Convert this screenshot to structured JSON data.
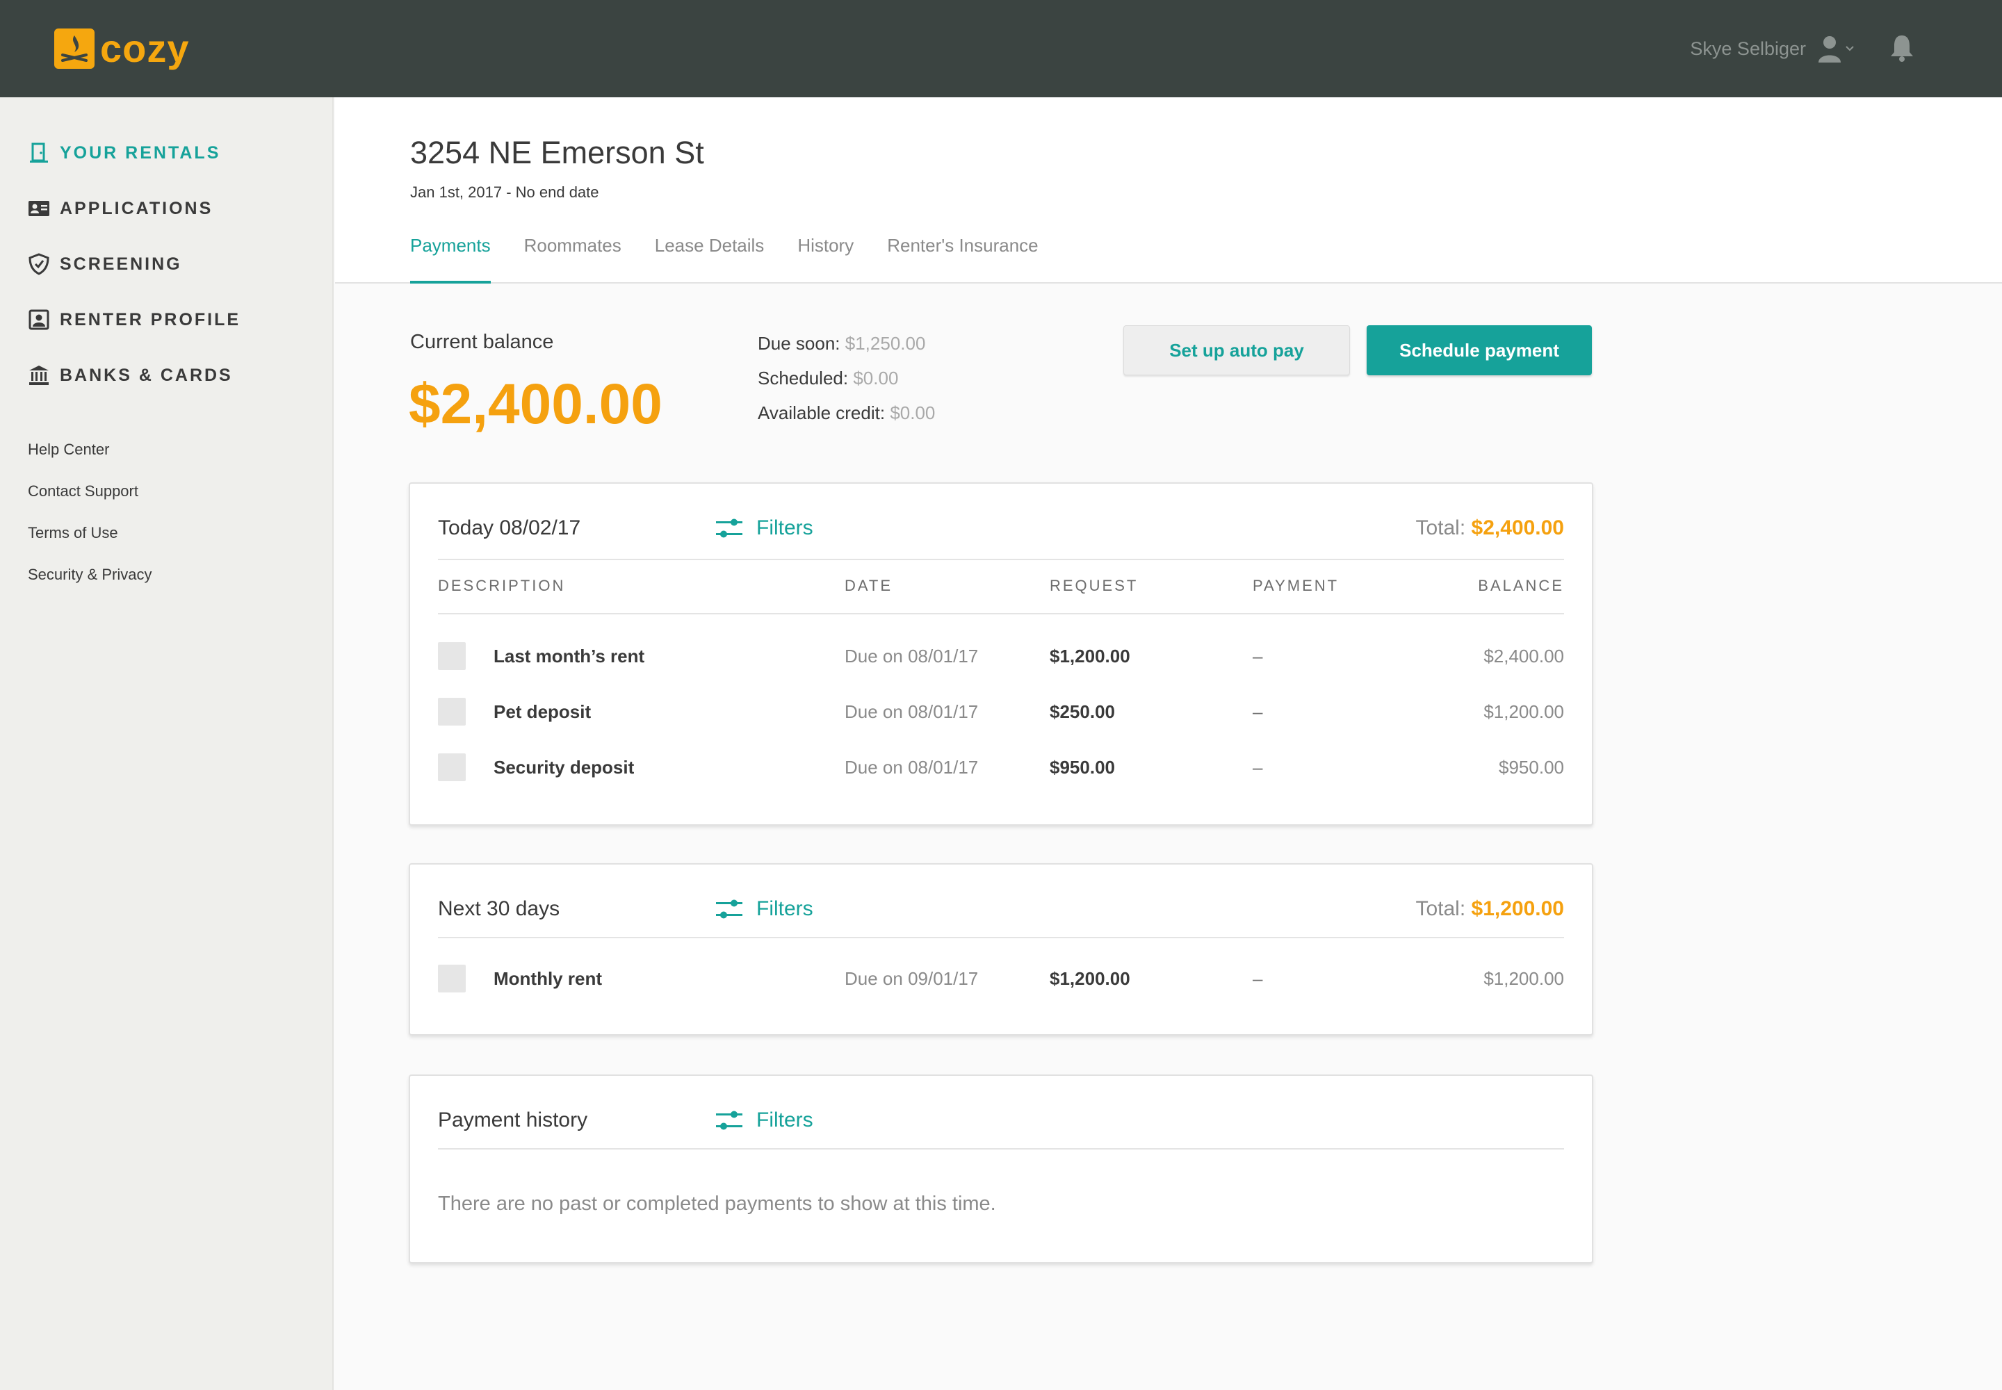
{
  "app": {
    "brand": "cozy",
    "brand_color": "#f5a70f",
    "accent_color": "#16a29a"
  },
  "topbar": {
    "user_name": "Skye Selbiger",
    "icons": [
      "user-icon",
      "chevron-down-icon",
      "bell-icon"
    ]
  },
  "sidebar": {
    "items": [
      {
        "label": "YOUR RENTALS",
        "icon": "door-icon",
        "active": true
      },
      {
        "label": "APPLICATIONS",
        "icon": "id-card-icon",
        "active": false
      },
      {
        "label": "SCREENING",
        "icon": "shield-icon",
        "active": false
      },
      {
        "label": "RENTER PROFILE",
        "icon": "profile-icon",
        "active": false
      },
      {
        "label": "BANKS & CARDS",
        "icon": "bank-icon",
        "active": false
      }
    ],
    "links": [
      "Help Center",
      "Contact Support",
      "Terms of Use",
      "Security & Privacy"
    ]
  },
  "header": {
    "title": "3254 NE Emerson St",
    "dates": "Jan 1st, 2017 - No end date",
    "tabs": [
      "Payments",
      "Roommates",
      "Lease Details",
      "History",
      "Renter's Insurance"
    ],
    "active_tab": "Payments"
  },
  "balance": {
    "label": "Current balance",
    "amount": "$2,400.00",
    "due_soon_label": "Due soon:",
    "due_soon_value": "$1,250.00",
    "scheduled_label": "Scheduled:",
    "scheduled_value": "$0.00",
    "credit_label": "Available credit:",
    "credit_value": "$0.00"
  },
  "actions": {
    "auto_pay": "Set up auto pay",
    "schedule": "Schedule payment"
  },
  "columns": [
    "DESCRIPTION",
    "DATE",
    "REQUEST",
    "PAYMENT",
    "BALANCE"
  ],
  "today": {
    "title": "Today 08/02/17",
    "filters": "Filters",
    "total_label": "Total:",
    "total_value": "$2,400.00",
    "rows": [
      {
        "desc": "Last month’s rent",
        "date": "Due on 08/01/17",
        "request": "$1,200.00",
        "payment": "–",
        "balance": "$2,400.00"
      },
      {
        "desc": "Pet deposit",
        "date": "Due on 08/01/17",
        "request": "$250.00",
        "payment": "–",
        "balance": "$1,200.00"
      },
      {
        "desc": "Security deposit",
        "date": "Due on 08/01/17",
        "request": "$950.00",
        "payment": "–",
        "balance": "$950.00"
      }
    ]
  },
  "next30": {
    "title": "Next 30 days",
    "filters": "Filters",
    "total_label": "Total:",
    "total_value": "$1,200.00",
    "rows": [
      {
        "desc": "Monthly rent",
        "date": "Due on 09/01/17",
        "request": "$1,200.00",
        "payment": "–",
        "balance": "$1,200.00"
      }
    ]
  },
  "history": {
    "title": "Payment history",
    "filters": "Filters",
    "empty": "There are no past or completed payments to show at this time."
  }
}
